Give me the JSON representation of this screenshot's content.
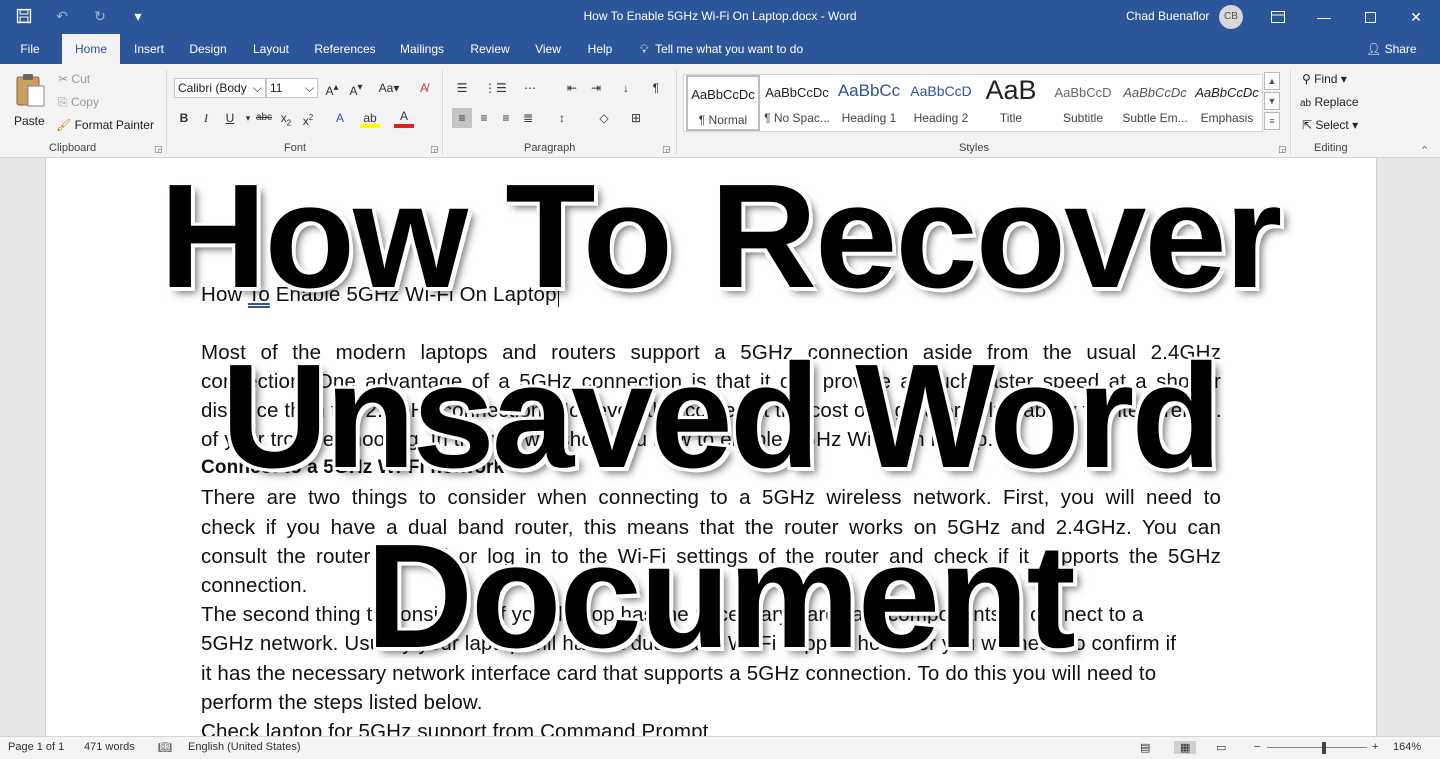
{
  "titlebar": {
    "doc_title": "How To Enable 5GHz Wi-Fi On Laptop.docx  -  Word",
    "user_name": "Chad Buenaflor",
    "avatar_initials": "CB"
  },
  "tabs": [
    "File",
    "Home",
    "Insert",
    "Design",
    "Layout",
    "References",
    "Mailings",
    "Review",
    "View",
    "Help"
  ],
  "tell_me": "Tell me what you want to do",
  "share": "Share",
  "clipboard": {
    "paste": "Paste",
    "cut": "Cut",
    "copy": "Copy",
    "format_painter": "Format Painter",
    "label": "Clipboard"
  },
  "font": {
    "name": "Calibri (Body",
    "size": "11",
    "label": "Font"
  },
  "paragraph": {
    "label": "Paragraph"
  },
  "styles": {
    "label": "Styles",
    "items": [
      {
        "sample": "AaBbCcDc",
        "name": "¶ Normal"
      },
      {
        "sample": "AaBbCcDc",
        "name": "¶ No Spac..."
      },
      {
        "sample": "AaBbCc",
        "name": "Heading 1"
      },
      {
        "sample": "AaBbCcD",
        "name": "Heading 2"
      },
      {
        "sample": "AaB",
        "name": "Title"
      },
      {
        "sample": "AaBbCcD",
        "name": "Subtitle"
      },
      {
        "sample": "AaBbCcDc",
        "name": "Subtle Em..."
      },
      {
        "sample": "AaBbCcDc",
        "name": "Emphasis"
      }
    ]
  },
  "editing": {
    "find": "Find",
    "replace": "Replace",
    "select": "Select",
    "label": "Editing"
  },
  "document": {
    "title_line_a": "How ",
    "title_line_b": "To",
    "title_line_c": " Enable 5GHz Wi-Fi On Laptop",
    "lines": [
      "Most of the modern laptops and routers support a 5GHz connection aside from the usual 2.4GHz",
      "connection. One advantage of a 5GHz connection is that it can provide a much faster speed at a shorter",
      "distance than the 2.4GHz connection. However, this comes at the cost of a greater vulnerability to interference.",
      "of your trouble shooting. In this we will show you how to enable 5GHz Wi-Fi on laptop."
    ],
    "heading": "Connect to a 5GHz Wi-Fi network",
    "lines2": [
      "There are two things to consider when connecting to a 5GHz wireless network. First, you will need to",
      "check if you have a dual band router, this means that the router works on 5GHz and 2.4GHz. You can",
      "consult the router manual or log in to the Wi-Fi settings of the router and check if it supports the 5GHz",
      "connection."
    ],
    "lines3": [
      "The second thing to consider is if your laptop has the necessary hardware components to connect to a",
      "5GHz network. Usually your laptop will have a dual band Wi-Fi support however you will need to confirm if",
      "it has the necessary network interface card that supports a 5GHz connection. To do this you will need to",
      "perform the steps listed below.",
      "Check laptop for 5GHz support from Command Prompt"
    ]
  },
  "overlay": {
    "line1": "How To Recover",
    "line2": "Unsaved Word",
    "line3": "Document"
  },
  "status": {
    "page": "Page 1 of 1",
    "words": "471 words",
    "language": "English (United States)",
    "zoom": "164%",
    "zoom_level": 0.55
  }
}
